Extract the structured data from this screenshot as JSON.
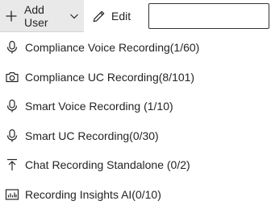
{
  "toolbar": {
    "add_user": {
      "label": "Add User",
      "icon": "plus-icon",
      "dropdown_icon": "chevron-down-icon"
    },
    "edit": {
      "label": "Edit",
      "icon": "pencil-icon"
    },
    "search": {
      "value": "",
      "placeholder": ""
    }
  },
  "menu": {
    "items": [
      {
        "label": "Compliance Voice Recording(1/60)",
        "icon": "microphone-icon"
      },
      {
        "label": "Compliance UC Recording(8/101)",
        "icon": "camera-icon"
      },
      {
        "label": "Smart Voice Recording (1/10)",
        "icon": "microphone-icon"
      },
      {
        "label": "Smart UC Recording(0/30)",
        "icon": "microphone-icon"
      },
      {
        "label": "Chat Recording Standalone (0/2)",
        "icon": "upload-arrow-icon"
      },
      {
        "label": "Recording Insights AI(0/10)",
        "icon": "bar-chart-icon"
      }
    ]
  },
  "colors": {
    "text": "#242424",
    "toolbar_button_bg": "#e9e9e9",
    "input_border": "#333333",
    "background": "#ffffff"
  }
}
